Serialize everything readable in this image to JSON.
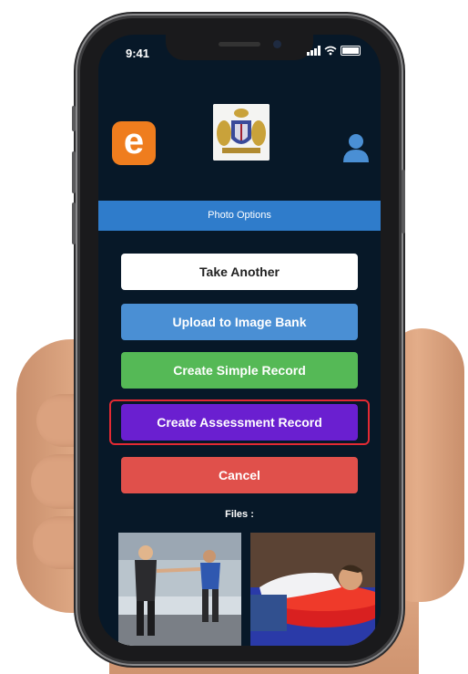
{
  "status_bar": {
    "time": "9:41"
  },
  "header": {
    "title": "Photo Options"
  },
  "buttons": {
    "take_another": "Take Another",
    "upload_to_image_bank": "Upload to Image Bank",
    "create_simple_record": "Create Simple Record",
    "create_assessment_record": "Create Assessment Record",
    "cancel": "Cancel"
  },
  "files": {
    "label": "Files :"
  },
  "app_logo": {
    "letter": "e"
  },
  "colors": {
    "header": "#2f7ccb",
    "upload": "#4a8fd4",
    "simple": "#55b956",
    "assessment": "#6a1fd0",
    "cancel": "#e0504b",
    "highlight": "#e22a33",
    "logo": "#ef7d1e"
  },
  "icons": [
    "user-icon",
    "crest-icon",
    "signal-icon",
    "wifi-icon",
    "battery-icon"
  ]
}
